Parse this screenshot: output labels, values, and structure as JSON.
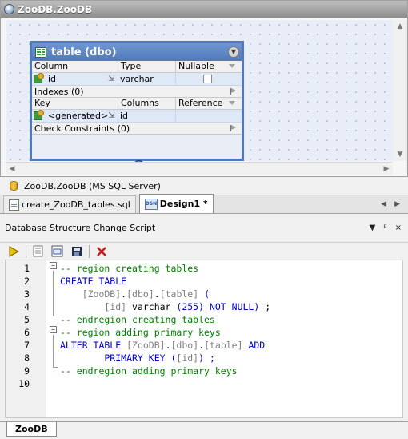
{
  "design": {
    "window_title": "ZooDB.ZooDB",
    "table": {
      "title": "table (dbo)",
      "col_headers": [
        "Column",
        "Type",
        "Nullable"
      ],
      "columns": [
        {
          "name": "id",
          "type": "varchar (255)"
        }
      ],
      "indexes_label": "Indexes (0)",
      "key_headers": [
        "Key",
        "Columns",
        "Reference"
      ],
      "keys": [
        {
          "name": "<generated>",
          "columns": "id"
        }
      ],
      "check_label": "Check Constraints (0)"
    }
  },
  "connection": {
    "label": "ZooDB.ZooDB (MS SQL Server)"
  },
  "tabs": [
    {
      "label": "create_ZooDB_tables.sql",
      "active": false
    },
    {
      "label": "Design1 *",
      "active": true
    }
  ],
  "panel": {
    "title": "Database Structure Change Script",
    "controls": [
      "▼",
      "ᵖ",
      "×"
    ]
  },
  "editor": {
    "line_numbers": [
      "1",
      "2",
      "3",
      "4",
      "5",
      "6",
      "7",
      "8",
      "9",
      "10"
    ],
    "lines": [
      [
        {
          "t": "-- region creating tables",
          "c": "cm"
        }
      ],
      [
        {
          "t": "CREATE TABLE",
          "c": "kw"
        }
      ],
      [
        {
          "t": "    [ZooDB]",
          "c": "id"
        },
        {
          "t": ".",
          "c": "txt"
        },
        {
          "t": "[dbo]",
          "c": "id"
        },
        {
          "t": ".",
          "c": "txt"
        },
        {
          "t": "[table]",
          "c": "id"
        },
        {
          "t": " (",
          "c": "kw"
        }
      ],
      [
        {
          "t": "        [id]",
          "c": "id"
        },
        {
          "t": " varchar ",
          "c": "txt"
        },
        {
          "t": "(255) NOT NULL)",
          "c": "kw"
        },
        {
          "t": " ;",
          "c": "txt"
        }
      ],
      [
        {
          "t": "-- endregion creating tables",
          "c": "cm"
        }
      ],
      [
        {
          "t": "-- region adding primary keys",
          "c": "cm"
        }
      ],
      [
        {
          "t": "ALTER TABLE",
          "c": "kw"
        },
        {
          "t": " [ZooDB]",
          "c": "id"
        },
        {
          "t": ".",
          "c": "txt"
        },
        {
          "t": "[dbo]",
          "c": "id"
        },
        {
          "t": ".",
          "c": "txt"
        },
        {
          "t": "[table]",
          "c": "id"
        },
        {
          "t": " ADD",
          "c": "kw"
        }
      ],
      [
        {
          "t": "        PRIMARY KEY (",
          "c": "kw"
        },
        {
          "t": "[id]",
          "c": "id"
        },
        {
          "t": ") ;",
          "c": "kw"
        }
      ],
      [
        {
          "t": "-- endregion adding primary keys",
          "c": "cm"
        }
      ],
      []
    ],
    "colors": {
      "keyword": "#0000cc",
      "comment": "#008000",
      "identifier": "#808080"
    }
  },
  "bottom_tab": {
    "label": "ZooDB"
  }
}
